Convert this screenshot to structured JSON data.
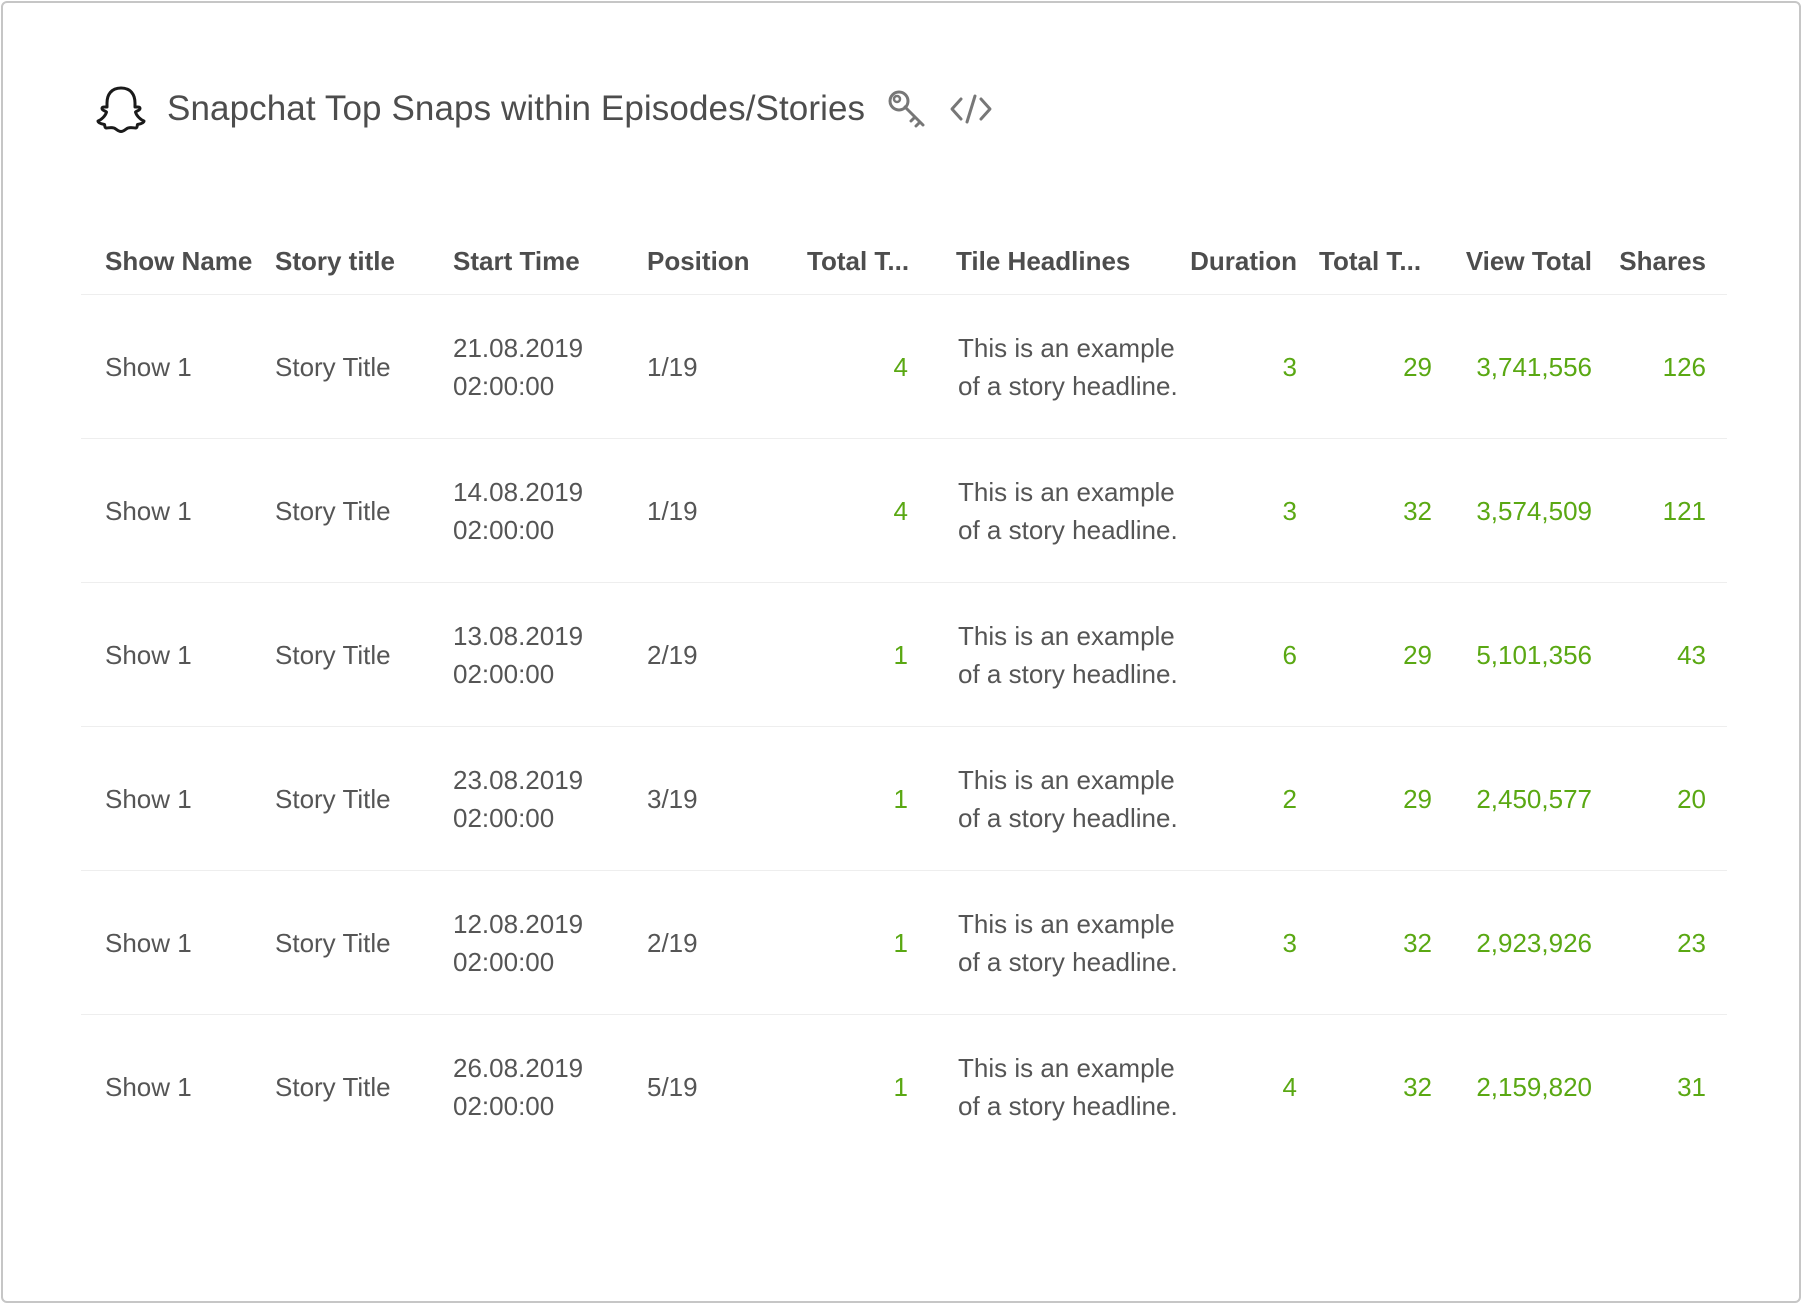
{
  "widget": {
    "title": "Snapchat Top Snaps within Episodes/Stories",
    "logo_icon": "snapchat-ghost-icon",
    "key_icon": "key-icon",
    "embed_icon": "code-embed-icon"
  },
  "table": {
    "columns": [
      "Show Name",
      "Story title",
      "Start Time",
      "Position",
      "Total T...",
      "Tile Headlines",
      "Duration",
      "Total T...",
      "View Total",
      "Shares"
    ],
    "rows": [
      {
        "show": "Show 1",
        "story": "Story Title",
        "date": "21.08.2019",
        "time": "02:00:00",
        "position": "1/19",
        "total_tiles": "4",
        "headline_1": "This is an example",
        "headline_2": "of a story headline.",
        "duration": "3",
        "total_time": "29",
        "view_total": "3,741,556",
        "shares": "126"
      },
      {
        "show": "Show 1",
        "story": "Story Title",
        "date": "14.08.2019",
        "time": "02:00:00",
        "position": "1/19",
        "total_tiles": "4",
        "headline_1": "This is an example",
        "headline_2": "of a story headline.",
        "duration": "3",
        "total_time": "32",
        "view_total": "3,574,509",
        "shares": "121"
      },
      {
        "show": "Show 1",
        "story": "Story Title",
        "date": "13.08.2019",
        "time": "02:00:00",
        "position": "2/19",
        "total_tiles": "1",
        "headline_1": "This is an example",
        "headline_2": "of a story headline.",
        "duration": "6",
        "total_time": "29",
        "view_total": "5,101,356",
        "shares": "43"
      },
      {
        "show": "Show 1",
        "story": "Story Title",
        "date": "23.08.2019",
        "time": "02:00:00",
        "position": "3/19",
        "total_tiles": "1",
        "headline_1": "This is an example",
        "headline_2": "of a story headline.",
        "duration": "2",
        "total_time": "29",
        "view_total": "2,450,577",
        "shares": "20"
      },
      {
        "show": "Show 1",
        "story": "Story Title",
        "date": "12.08.2019",
        "time": "02:00:00",
        "position": "2/19",
        "total_tiles": "1",
        "headline_1": "This is an example",
        "headline_2": "of a story headline.",
        "duration": "3",
        "total_time": "32",
        "view_total": "2,923,926",
        "shares": "23"
      },
      {
        "show": "Show 1",
        "story": "Story Title",
        "date": "26.08.2019",
        "time": "02:00:00",
        "position": "5/19",
        "total_tiles": "1",
        "headline_1": "This is an example",
        "headline_2": "of a story headline.",
        "duration": "4",
        "total_time": "32",
        "view_total": "2,159,820",
        "shares": "31"
      }
    ]
  },
  "colors": {
    "metric_value": "#5aa813",
    "text": "#555555",
    "header_text": "#4d4d4d",
    "border": "#c6c6c6"
  }
}
